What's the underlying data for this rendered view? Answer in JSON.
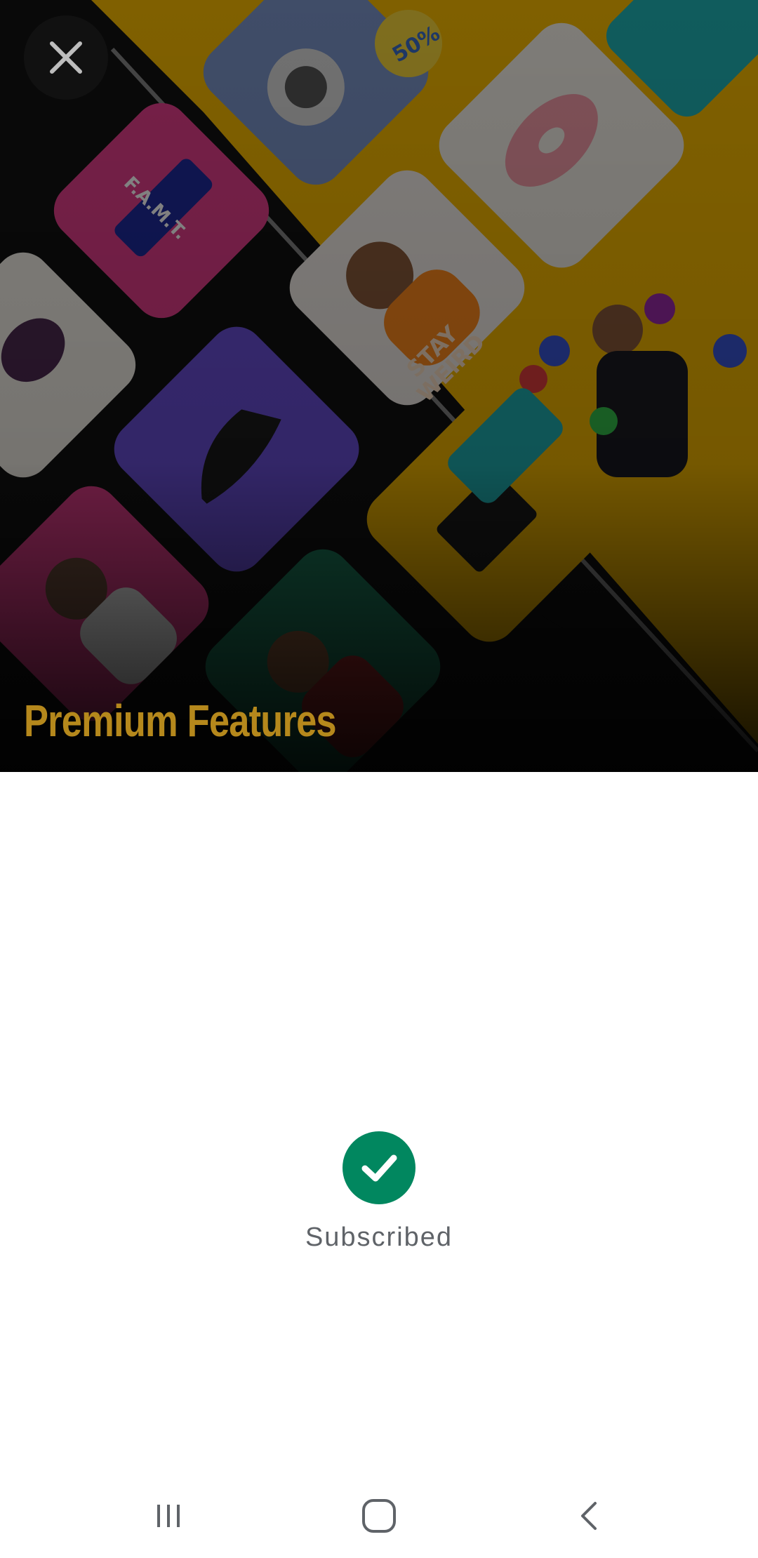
{
  "hero": {
    "title": "Premium Features",
    "title_color": "#b5881c",
    "close_icon": "close-icon",
    "art_tiles": [
      {
        "name": "headphones-tile",
        "badge": "50%"
      },
      {
        "name": "donut-tile"
      },
      {
        "name": "lighter-tile",
        "caption": "F.A.M.T."
      },
      {
        "name": "stay-weird-tile",
        "caption": "STAY WEIRD"
      },
      {
        "name": "smiley-person-tile"
      },
      {
        "name": "plum-tile"
      },
      {
        "name": "sneaker-tile"
      },
      {
        "name": "cassette-tile"
      },
      {
        "name": "woman-portrait-tile"
      },
      {
        "name": "man-portrait-tile"
      }
    ]
  },
  "status": {
    "icon": "check-circle-icon",
    "label": "Subscribed",
    "color": "#01875f"
  },
  "navbar": {
    "recents_icon": "recents-icon",
    "home_icon": "home-icon",
    "back_icon": "back-icon"
  }
}
